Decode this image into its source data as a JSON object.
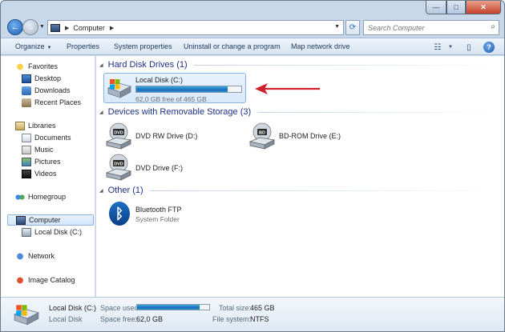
{
  "window": {
    "caption_min": "—",
    "caption_max": "□",
    "caption_close": "✕"
  },
  "address": {
    "back_glyph": "←",
    "forward_glyph": "→",
    "location": "Computer",
    "search_placeholder": "Search Computer",
    "refresh_glyph": "⟳",
    "search_glyph": "⌕"
  },
  "toolbar": {
    "organize": "Organize",
    "properties": "Properties",
    "system_properties": "System properties",
    "uninstall": "Uninstall or change a program",
    "map_drive": "Map network drive",
    "help": "?"
  },
  "sidebar": {
    "favorites": "Favorites",
    "desktop": "Desktop",
    "downloads": "Downloads",
    "recent_places": "Recent Places",
    "libraries": "Libraries",
    "documents": "Documents",
    "music": "Music",
    "pictures": "Pictures",
    "videos": "Videos",
    "homegroup": "Homegroup",
    "computer": "Computer",
    "local_disk": "Local Disk (C:)",
    "network": "Network",
    "image_catalog": "Image Catalog"
  },
  "groups": {
    "hdd_header": "Hard Disk Drives (1)",
    "removable_header": "Devices with Removable Storage (3)",
    "other_header": "Other (1)"
  },
  "drives": {
    "local": {
      "name": "Local Disk (C:)",
      "free_text": "62,0 GB free of 465 GB",
      "used_fraction": 0.867
    },
    "dvd_rw": {
      "name": "DVD RW Drive (D:)",
      "badge": "DVD"
    },
    "bd_rom": {
      "name": "BD-ROM Drive (E:)",
      "badge": "BD"
    },
    "dvd": {
      "name": "DVD Drive (F:)",
      "badge": "DVD"
    },
    "bluetooth": {
      "name": "Bluetooth FTP",
      "type": "System Folder",
      "glyph": "ᛒ"
    }
  },
  "details": {
    "name": "Local Disk (C:)",
    "type": "Local Disk",
    "space_used_label": "Space used:",
    "space_free_label": "Space free:",
    "space_free_value": "62,0 GB",
    "total_size_label": "Total size:",
    "total_size_value": "465 GB",
    "filesystem_label": "File system:",
    "filesystem_value": "NTFS",
    "used_fraction": 0.867
  },
  "colors": {
    "annotation_arrow": "#d0202a",
    "header_text": "#1e3287"
  }
}
